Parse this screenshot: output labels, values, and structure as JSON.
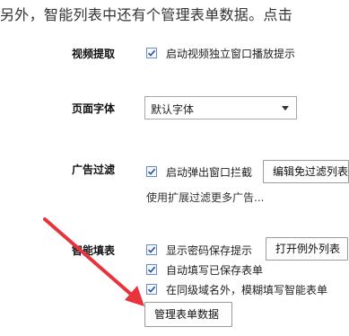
{
  "intro_text": "另外，智能列表中还有个管理表单数据。点击",
  "sections": {
    "video": {
      "label": "视频提取",
      "checkbox_label": "启动视频独立窗口播放提示"
    },
    "font": {
      "label": "页面字体",
      "select_value": "默认字体"
    },
    "ad": {
      "label": "广告过滤",
      "checkbox_label": "启动弹出窗口拦截",
      "button_label": "编辑免过滤列表",
      "hint": "使用扩展过滤更多广告..."
    },
    "smart_fill": {
      "label": "智能填表",
      "options": [
        {
          "label": "显示密码保存提示",
          "checked": true
        },
        {
          "label": "自动填写已保存表单",
          "checked": true
        },
        {
          "label": "在同级域名外，模糊填写智能表单",
          "checked": true
        }
      ],
      "exception_button_label": "打开例外列表",
      "manage_button_label": "管理表单数据"
    }
  },
  "colors": {
    "annotation_arrow": "#e8333c",
    "checkbox_border": "#6b8cc7"
  },
  "icons": {
    "checkmark": "check-icon",
    "dropdown": "chevron-down-icon",
    "pointer": "red-arrow-annotation"
  }
}
